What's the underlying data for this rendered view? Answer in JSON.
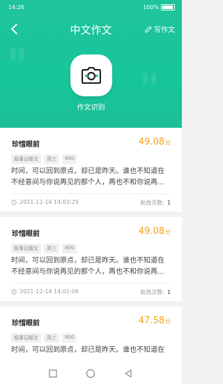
{
  "status": {
    "time": "14:26",
    "battery": "100%"
  },
  "header": {
    "title": "中文作文",
    "write_label": "写作文",
    "identify_label": "作文识别"
  },
  "cards": [
    {
      "title": "珍惜眼前",
      "score": "49.08",
      "unit": "分",
      "tags": [
        "叙事记叙文",
        "高三",
        "800"
      ],
      "lines": [
        "时间，可以回到原点，却已是昨天。谁也不知道在",
        "不经意间与你说再见的那个人，再也不和你说再..."
      ],
      "date": "2021-12-14 14:03:25",
      "count_label": "批改次数:",
      "count": "1"
    },
    {
      "title": "珍惜眼前",
      "score": "49.08",
      "unit": "分",
      "tags": [
        "叙事记叙文",
        "高三",
        "800"
      ],
      "lines": [
        "时间，可以回到原点，却已是昨天。谁也不知道在",
        "不经意间与你说再见的那个人，再也不和你说再..."
      ],
      "date": "2021-12-14 14:01:06",
      "count_label": "批改次数:",
      "count": "1"
    },
    {
      "title": "珍惜眼前",
      "score": "47.58",
      "unit": "分",
      "tags": [
        "叙事记叙文",
        "高三",
        "800"
      ],
      "lines": [
        "时间，可以回到原点，却已是昨天。谁也不知道在"
      ],
      "date": "",
      "count_label": "",
      "count": ""
    }
  ]
}
